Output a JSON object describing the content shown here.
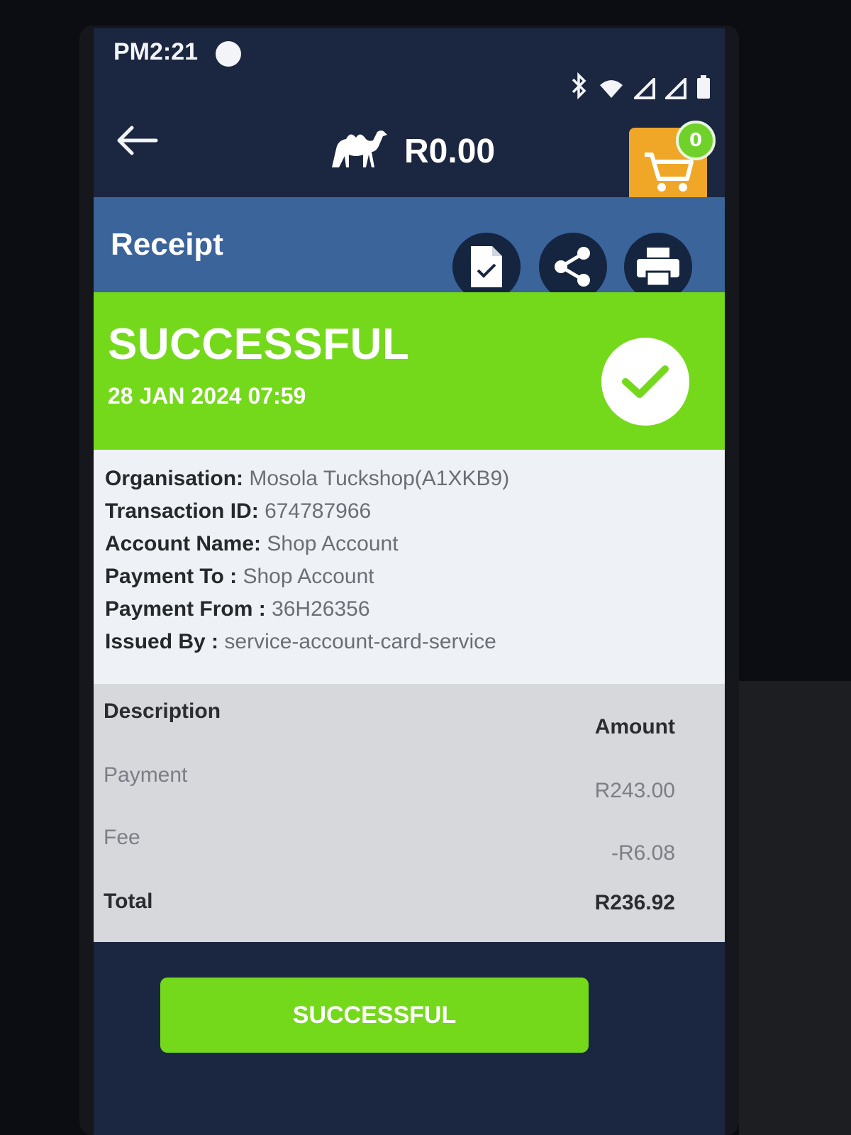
{
  "status_bar": {
    "time": "PM2:21",
    "icons": [
      "bluetooth-icon",
      "wifi-icon",
      "signal-icon",
      "signal-icon",
      "battery-icon"
    ]
  },
  "header": {
    "logo_icon": "camel-icon",
    "balance": "R0.00",
    "cart_count": "0",
    "cart_color": "#f0a728"
  },
  "receipt_bar": {
    "title": "Receipt",
    "actions": [
      "document-check-icon",
      "share-icon",
      "printer-icon"
    ]
  },
  "status_banner": {
    "status": "SUCCESSFUL",
    "datetime": "28 JAN 2024 07:59",
    "color": "#74d91a"
  },
  "details": [
    {
      "label": "Organisation:",
      "value": "Mosola Tuckshop(A1XKB9)"
    },
    {
      "label": "Transaction ID:",
      "value": "674787966"
    },
    {
      "label": "Account Name:",
      "value": "Shop Account"
    },
    {
      "label": "Payment To :",
      "value": "Shop Account"
    },
    {
      "label": "Payment From :",
      "value": "36H26356"
    },
    {
      "label": "Issued By :",
      "value": "service-account-card-service"
    }
  ],
  "table": {
    "headers": {
      "description": "Description",
      "amount": "Amount"
    },
    "rows": [
      {
        "description": "Payment",
        "amount": "R243.00"
      },
      {
        "description": "Fee",
        "amount": "-R6.08"
      }
    ],
    "total": {
      "label": "Total",
      "amount": "R236.92"
    }
  },
  "footer": {
    "button_label": "SUCCESSFUL"
  }
}
